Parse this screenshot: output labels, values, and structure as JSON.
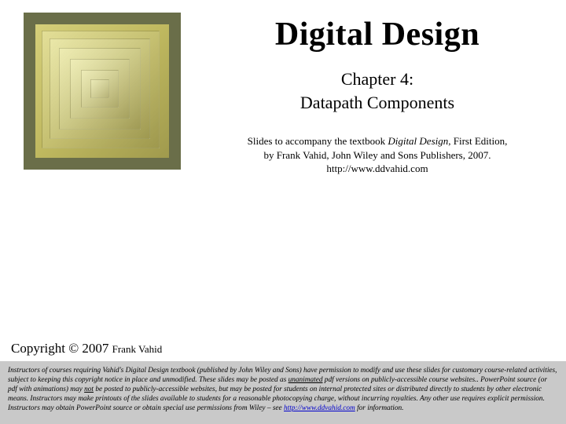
{
  "title": "Digital Design",
  "chapter_line1": "Chapter 4:",
  "chapter_line2": "Datapath Components",
  "credit_prefix": "Slides to accompany the textbook ",
  "credit_book": "Digital Design",
  "credit_suffix": ", First Edition,",
  "credit_line2": "by Frank Vahid, John Wiley and Sons Publishers, 2007.",
  "credit_url": "http://www.ddvahid.com",
  "copyright_main": "Copyright © 2007 ",
  "copyright_author": "Frank Vahid",
  "legal_p1a": "Instructors of courses requiring Vahid's Digital Design textbook (published by John Wiley and Sons) have permission to modify and use these slides for customary course-related activities, subject to keeping this copyright notice in place and unmodified. These slides may be posted as ",
  "legal_u1": "unanimated",
  "legal_p1b": " pdf versions on publicly-accessible course websites.. PowerPoint source (or pdf with animations) may ",
  "legal_u2": "not",
  "legal_p1c": " be posted to publicly-accessible websites, but may be posted for students on internal protected sites or distributed directly to students by other electronic means. Instructors may make printouts of the slides available to students for a reasonable photocopying charge, without incurring royalties. Any other use requires explicit permission. Instructors may obtain PowerPoint source or obtain special use permissions from Wiley – see ",
  "legal_link": "http://www.ddvahid.com",
  "legal_p1d": " for information."
}
